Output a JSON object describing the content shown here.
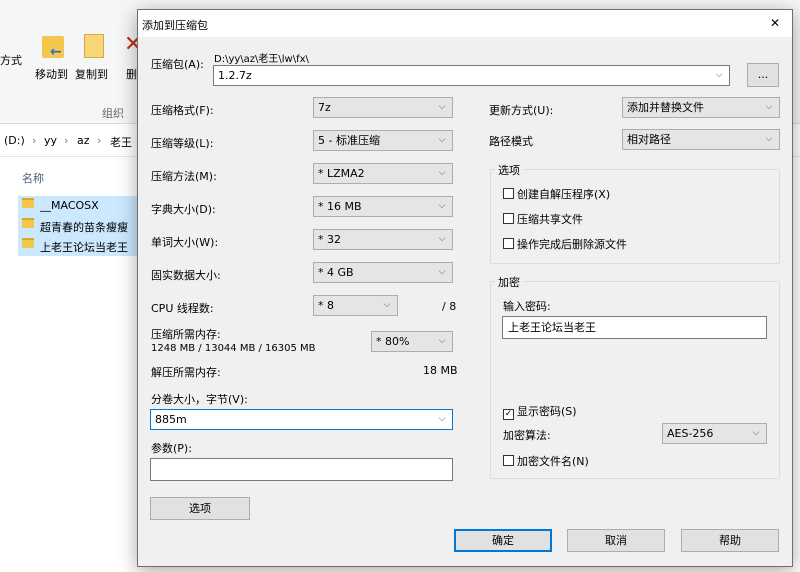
{
  "explorer": {
    "ribbon": {
      "left_label": "方式",
      "move_to": "移动到",
      "copy_to": "复制到",
      "delete_partial": "删",
      "group_label": "组织"
    },
    "breadcrumb": [
      "(D:)",
      "yy",
      "az",
      "老王"
    ],
    "column_header": "名称",
    "files": [
      "__MACOSX",
      "超青春的苗条瘦瘦",
      "上老王论坛当老王"
    ]
  },
  "dialog": {
    "title": "添加到压缩包",
    "close_glyph": "✕",
    "archive": {
      "label": "压缩包(A):",
      "path": "D:\\yy\\az\\老王\\lw\\fx\\",
      "filename": "1.2.7z",
      "browse_label": "..."
    },
    "left": {
      "format_label": "压缩格式(F):",
      "format_value": "7z",
      "level_label": "压缩等级(L):",
      "level_value": "5 - 标准压缩",
      "method_label": "压缩方法(M):",
      "method_value": "* LZMA2",
      "dict_label": "字典大小(D):",
      "dict_value": "* 16 MB",
      "word_label": "单词大小(W):",
      "word_value": "* 32",
      "solid_label": "固实数据大小:",
      "solid_value": "* 4 GB",
      "threads_label": "CPU 线程数:",
      "threads_value": "* 8",
      "threads_max": "/ 8",
      "mem_comp_label": "压缩所需内存:",
      "mem_comp_value": "1248 MB / 13044 MB / 16305 MB",
      "mem_percent": "* 80%",
      "mem_decomp_label": "解压所需内存:",
      "mem_decomp_value": "18 MB",
      "volume_label": "分卷大小，字节(V):",
      "volume_value": "885m",
      "params_label": "参数(P):",
      "params_value": "",
      "options_button": "选项"
    },
    "right": {
      "update_label": "更新方式(U):",
      "update_value": "添加并替换文件",
      "path_label": "路径模式",
      "path_value": "相对路径",
      "options_group": "选项",
      "opt_sfx": "创建自解压程序(X)",
      "opt_shared": "压缩共享文件",
      "opt_delete": "操作完成后删除源文件",
      "encryption_group": "加密",
      "password_label": "输入密码:",
      "password_value": "上老王论坛当老王",
      "show_password": "显示密码(S)",
      "show_password_checked": true,
      "enc_method_label": "加密算法:",
      "enc_method_value": "AES-256",
      "encrypt_names": "加密文件名(N)"
    },
    "buttons": {
      "ok": "确定",
      "cancel": "取消",
      "help": "帮助"
    },
    "check_glyph": "✓",
    "chevron_glyph": "⌵"
  },
  "colors": {
    "accent": "#0078d7",
    "dialog_bg": "#f0f0f0",
    "selection": "#cce8ff",
    "folder": "#f3c64d"
  }
}
